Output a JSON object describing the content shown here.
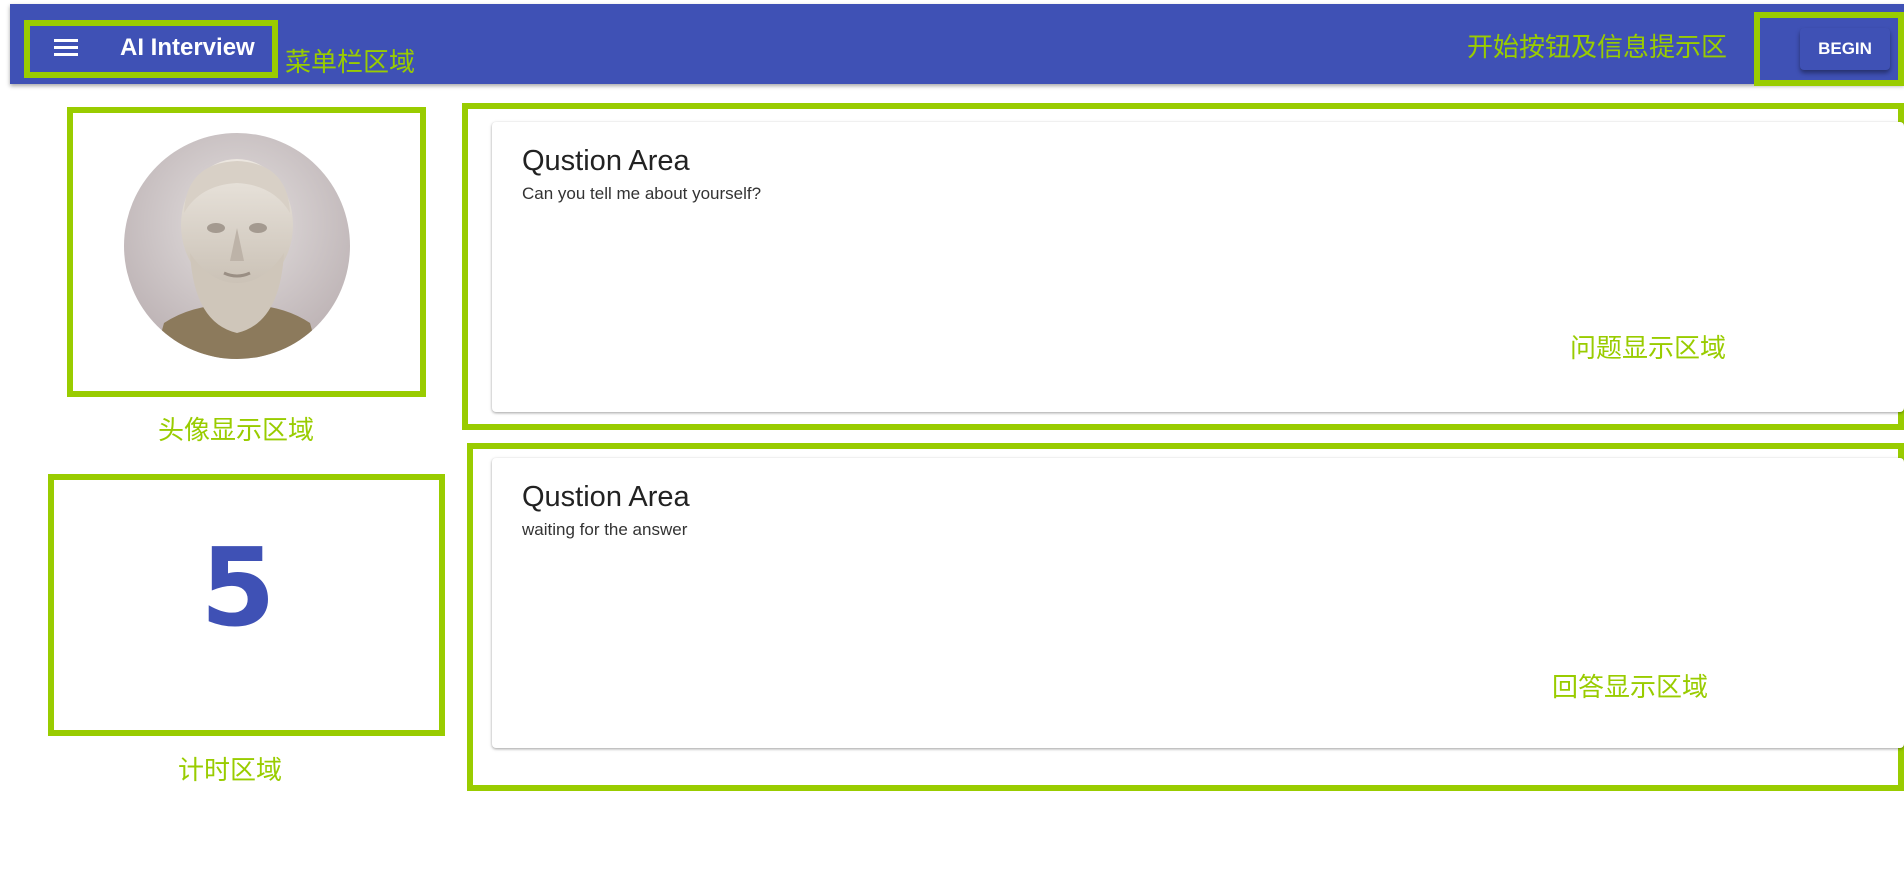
{
  "appbar": {
    "title": "AI Interview",
    "begin_label": "BEGIN",
    "color": "#3f51b5"
  },
  "annotations": {
    "menu_area": "菜单栏区域",
    "begin_area": "开始按钮及信息提示区",
    "avatar_area": "头像显示区域",
    "timer_area": "计时区域",
    "question_area": "问题显示区域",
    "answer_area": "回答显示区域",
    "color": "#99cc00"
  },
  "timer": {
    "value": "5"
  },
  "question_card": {
    "title": "Qustion Area",
    "text": "Can you tell me about yourself?"
  },
  "answer_card": {
    "title": "Qustion Area",
    "text": "waiting for the answer"
  }
}
